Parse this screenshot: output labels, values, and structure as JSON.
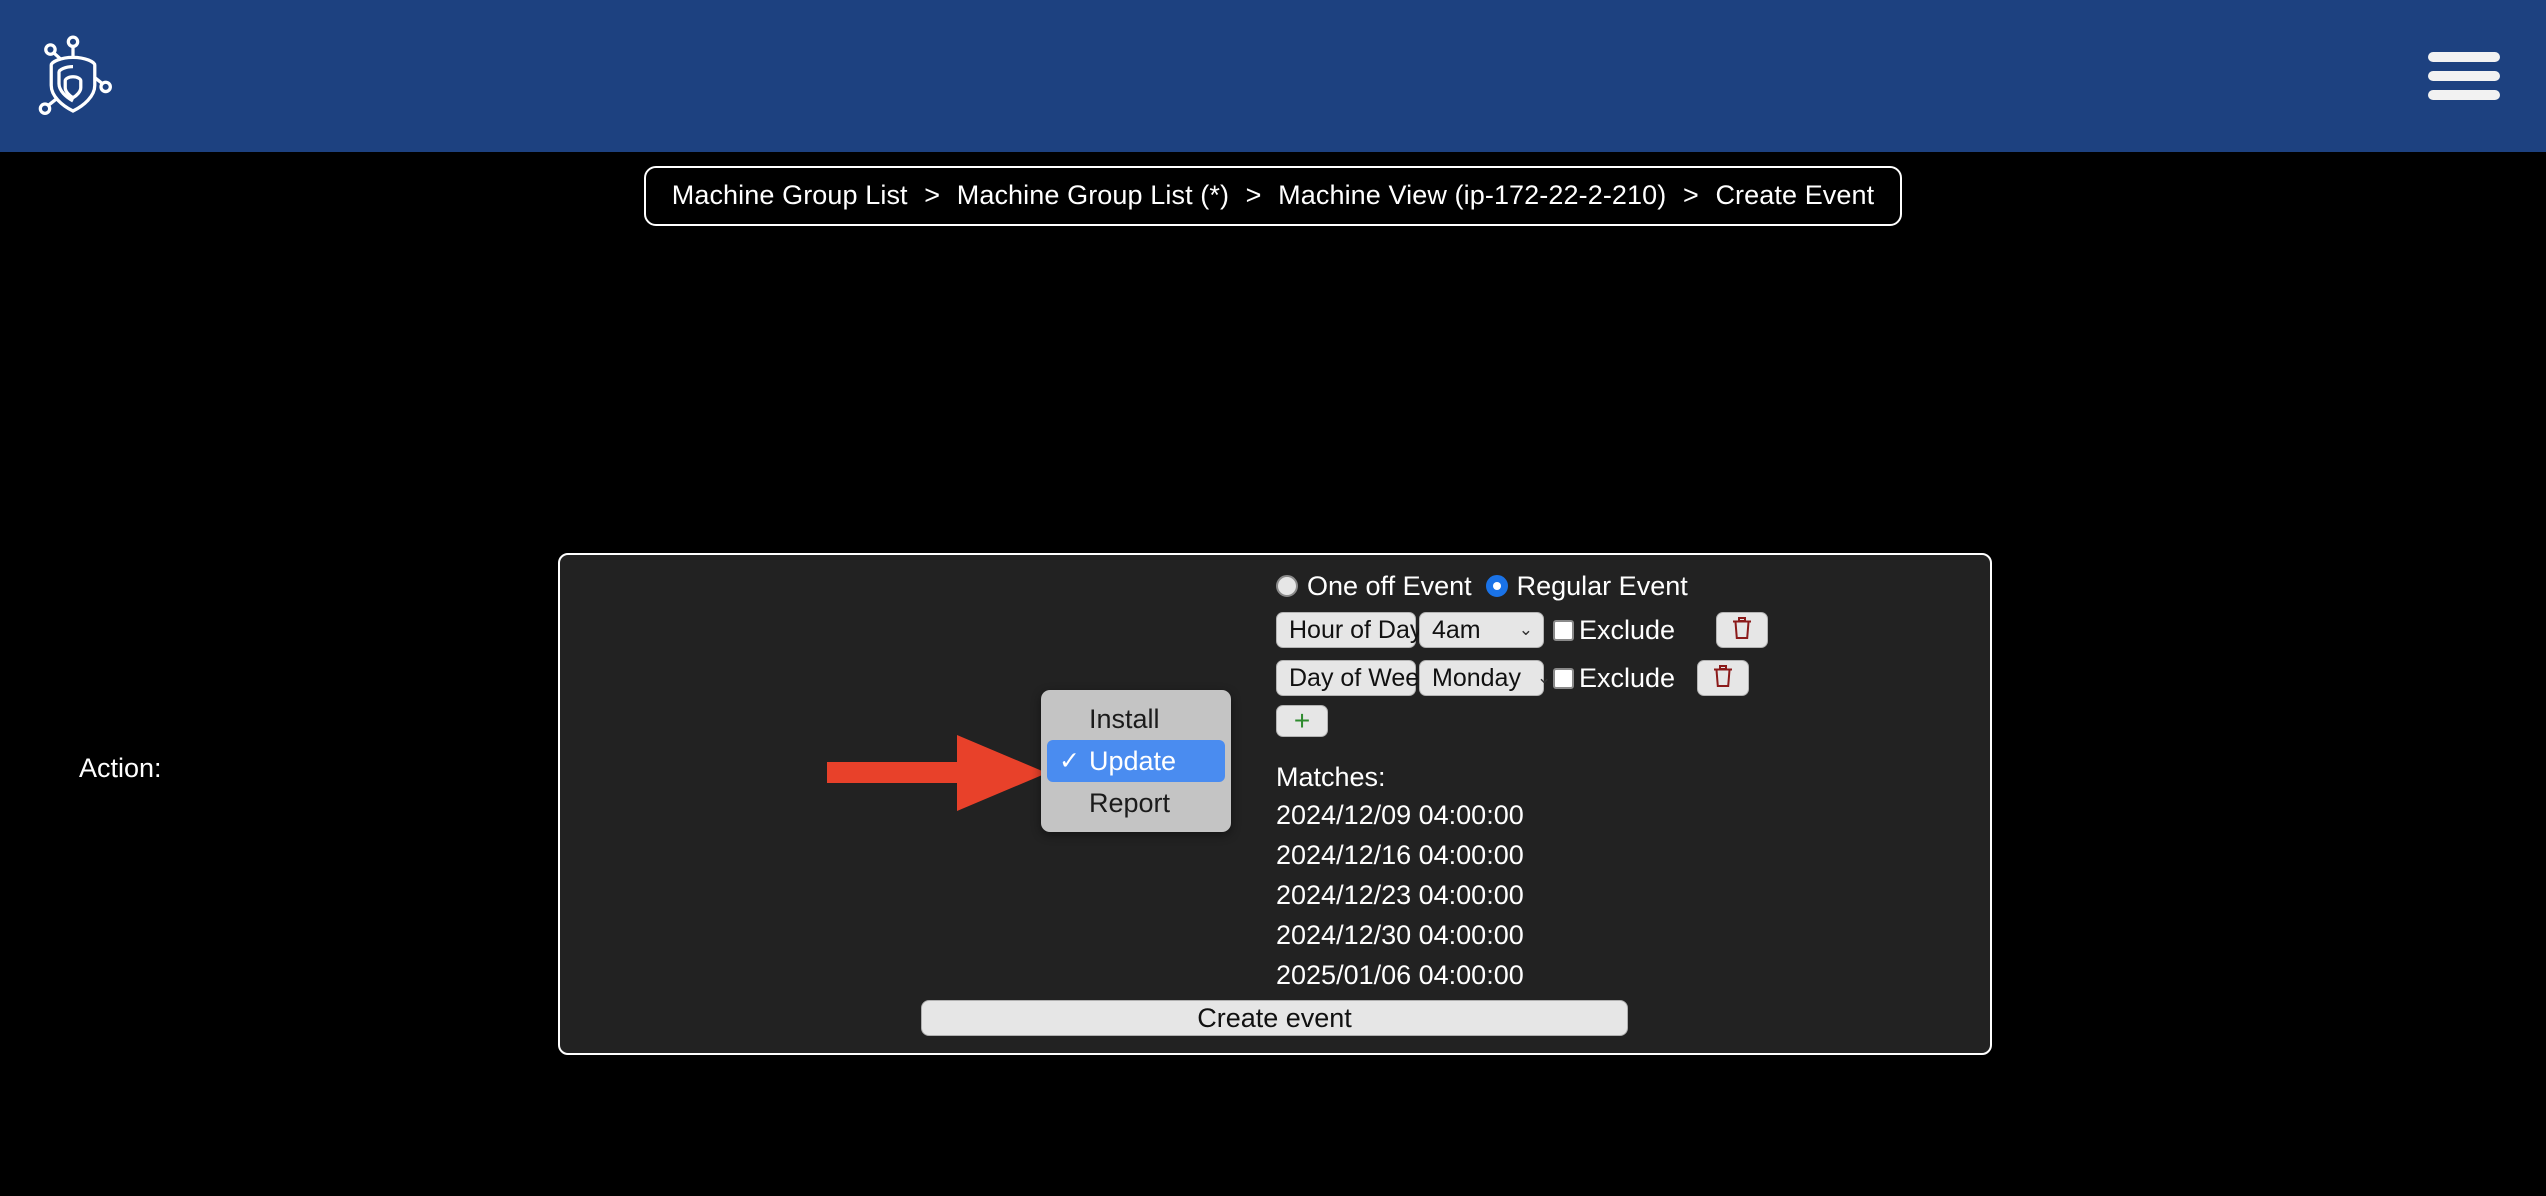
{
  "header": {
    "logo_icon": "shield-circuit-logo",
    "menu_icon": "hamburger-menu-icon",
    "background_color": "#1d4180"
  },
  "breadcrumb": {
    "separator": ">",
    "items": [
      "Machine Group List",
      "Machine Group List (*)",
      "Machine View (ip-172-22-2-210)",
      "Create Event"
    ]
  },
  "panel": {
    "action_label": "Action:",
    "arrow_icon": "red-right-arrow-annotation",
    "arrow_color": "#e8412a",
    "action_dropdown": {
      "options": [
        {
          "label": "Install",
          "selected": false,
          "check": ""
        },
        {
          "label": "Update",
          "selected": true,
          "check": "✓"
        },
        {
          "label": "Report",
          "selected": false,
          "check": ""
        }
      ],
      "selected_value": "Update",
      "highlight_color": "#4a8cf0"
    },
    "event_type": {
      "options": [
        {
          "label": "One off Event",
          "checked": false
        },
        {
          "label": "Regular Event",
          "checked": true
        }
      ],
      "selected": "Regular Event",
      "radio_checked_color": "#1a73e8"
    },
    "conditions": [
      {
        "field": "Hour of Day",
        "value": "4am",
        "exclude_label": "Exclude",
        "exclude_checked": false,
        "delete_icon": "trash-icon"
      },
      {
        "field": "Day of Week",
        "value": "Monday",
        "exclude_label": "Exclude",
        "exclude_checked": false,
        "delete_icon": "trash-icon"
      }
    ],
    "add_condition_label": "+",
    "add_condition_color": "#2e8b2e",
    "chevron_glyph": "⌄",
    "matches": {
      "heading": "Matches:",
      "items": [
        "2024/12/09 04:00:00",
        "2024/12/16 04:00:00",
        "2024/12/23 04:00:00",
        "2024/12/30 04:00:00",
        "2025/01/06 04:00:00"
      ]
    },
    "create_button_label": "Create event"
  }
}
